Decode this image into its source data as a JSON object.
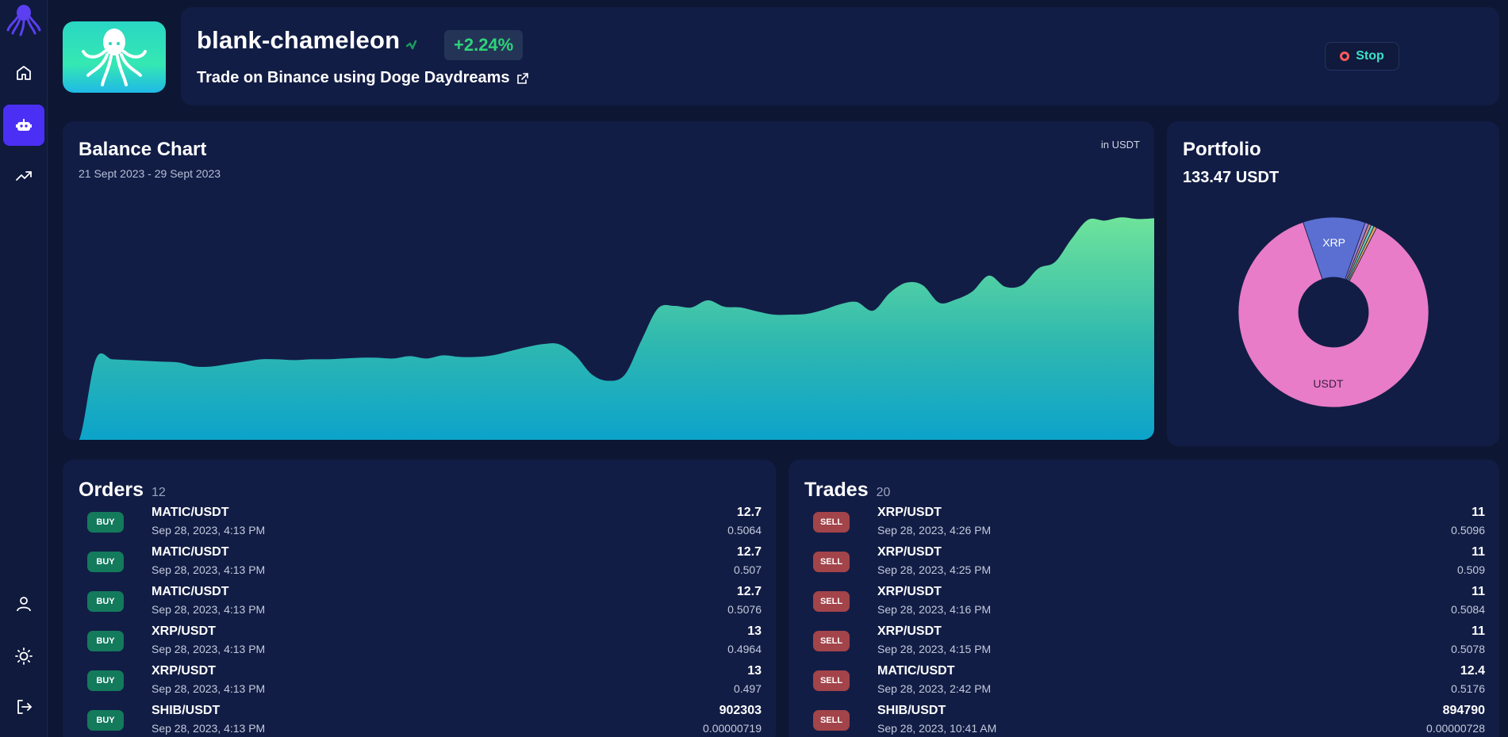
{
  "sidebar": {
    "items": [
      {
        "name": "home-icon"
      },
      {
        "name": "robot-icon",
        "active": true
      },
      {
        "name": "trending-up-icon"
      }
    ],
    "bottom_items": [
      {
        "name": "user-icon"
      },
      {
        "name": "sun-icon"
      },
      {
        "name": "logout-icon"
      }
    ]
  },
  "bot": {
    "name": "blank-chameleon",
    "change": "+2.24%",
    "subtitle": "Trade on Binance using Doge Daydreams",
    "stop_label": "Stop"
  },
  "colors": {
    "accent": "#4b2ff5",
    "positive": "#2ed47a",
    "buy": "#137a5b",
    "sell": "#a2444a",
    "stop": "#3fe0c5"
  },
  "balance": {
    "title": "Balance Chart",
    "range": "21 Sept 2023 - 29 Sept 2023",
    "unit": "in USDT"
  },
  "portfolio": {
    "title": "Portfolio",
    "total": "133.47 USDT"
  },
  "chart_data": [
    {
      "type": "area",
      "title": "Balance Chart",
      "subtitle": "21 Sept 2023 - 29 Sept 2023",
      "unit": "in USDT",
      "ylim": [
        130.3,
        133.6
      ],
      "values": [
        130.3,
        130.3,
        131.31,
        131.31,
        131.3,
        131.29,
        131.28,
        131.27,
        131.22,
        131.22,
        131.25,
        131.28,
        131.31,
        131.31,
        131.3,
        131.31,
        131.31,
        131.32,
        131.33,
        131.33,
        131.32,
        131.35,
        131.32,
        131.36,
        131.34,
        131.34,
        131.36,
        131.41,
        131.46,
        131.5,
        131.5,
        131.36,
        131.12,
        131.04,
        131.12,
        131.55,
        131.95,
        131.98,
        131.96,
        132.05,
        131.97,
        131.96,
        131.91,
        131.87,
        131.87,
        131.88,
        131.93,
        132.0,
        132.03,
        131.92,
        132.14,
        132.27,
        132.24,
        132.02,
        132.06,
        132.16,
        132.36,
        132.22,
        132.24,
        132.45,
        132.53,
        132.82,
        133.06,
        133.05,
        133.09,
        133.07,
        133.08
      ],
      "grid": false,
      "legend": "none"
    },
    {
      "type": "pie",
      "title": "Portfolio",
      "labels": [
        "USDT",
        "XRP",
        "",
        "",
        "",
        ""
      ],
      "values": [
        87.3,
        10.6,
        0.6,
        0.5,
        0.5,
        0.5
      ],
      "colors": [
        "#e87cc8",
        "#5a6fd1",
        "#9b7fd8",
        "#c98a7d",
        "#6ad1c3",
        "#e0a35a"
      ],
      "legend": "none"
    }
  ],
  "orders": {
    "title": "Orders",
    "count": "12",
    "items": [
      {
        "side": "BUY",
        "pair": "MATIC/USDT",
        "time": "Sep 28, 2023, 4:13 PM",
        "qty": "12.7",
        "price": "0.5064"
      },
      {
        "side": "BUY",
        "pair": "MATIC/USDT",
        "time": "Sep 28, 2023, 4:13 PM",
        "qty": "12.7",
        "price": "0.507"
      },
      {
        "side": "BUY",
        "pair": "MATIC/USDT",
        "time": "Sep 28, 2023, 4:13 PM",
        "qty": "12.7",
        "price": "0.5076"
      },
      {
        "side": "BUY",
        "pair": "XRP/USDT",
        "time": "Sep 28, 2023, 4:13 PM",
        "qty": "13",
        "price": "0.4964"
      },
      {
        "side": "BUY",
        "pair": "XRP/USDT",
        "time": "Sep 28, 2023, 4:13 PM",
        "qty": "13",
        "price": "0.497"
      },
      {
        "side": "BUY",
        "pair": "SHIB/USDT",
        "time": "Sep 28, 2023, 4:13 PM",
        "qty": "902303",
        "price": "0.00000719"
      }
    ]
  },
  "trades": {
    "title": "Trades",
    "count": "20",
    "items": [
      {
        "side": "SELL",
        "pair": "XRP/USDT",
        "time": "Sep 28, 2023, 4:26 PM",
        "qty": "11",
        "price": "0.5096"
      },
      {
        "side": "SELL",
        "pair": "XRP/USDT",
        "time": "Sep 28, 2023, 4:25 PM",
        "qty": "11",
        "price": "0.509"
      },
      {
        "side": "SELL",
        "pair": "XRP/USDT",
        "time": "Sep 28, 2023, 4:16 PM",
        "qty": "11",
        "price": "0.5084"
      },
      {
        "side": "SELL",
        "pair": "XRP/USDT",
        "time": "Sep 28, 2023, 4:15 PM",
        "qty": "11",
        "price": "0.5078"
      },
      {
        "side": "SELL",
        "pair": "MATIC/USDT",
        "time": "Sep 28, 2023, 2:42 PM",
        "qty": "12.4",
        "price": "0.5176"
      },
      {
        "side": "SELL",
        "pair": "SHIB/USDT",
        "time": "Sep 28, 2023, 10:41 AM",
        "qty": "894790",
        "price": "0.00000728"
      }
    ]
  }
}
